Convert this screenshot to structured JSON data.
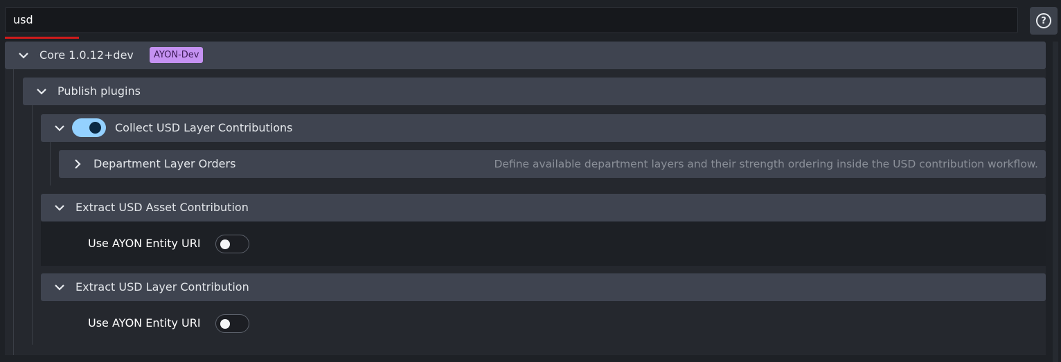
{
  "search": {
    "value": "usd"
  },
  "help_icon": "help-circle-icon",
  "core": {
    "title": "Core 1.0.12+dev",
    "badge": "AYON-Dev"
  },
  "publish_plugins": {
    "title": "Publish plugins"
  },
  "collect_usd": {
    "title": "Collect USD Layer Contributions",
    "enabled": true
  },
  "department_layer_orders": {
    "title": "Department Layer Orders",
    "description": "Define available department layers and their strength ordering inside the USD contribution workflow."
  },
  "extract_asset": {
    "title": "Extract USD Asset Contribution",
    "field_label": "Use AYON Entity URI",
    "field_enabled": false
  },
  "extract_layer": {
    "title": "Extract USD Layer Contribution",
    "field_label": "Use AYON Entity URI",
    "field_enabled": false
  },
  "colors": {
    "search_underline": "#d01b1b",
    "badge_bg": "#c592f2",
    "toggle_on": "#94d1ff",
    "panel_bg": "#3f4450"
  }
}
